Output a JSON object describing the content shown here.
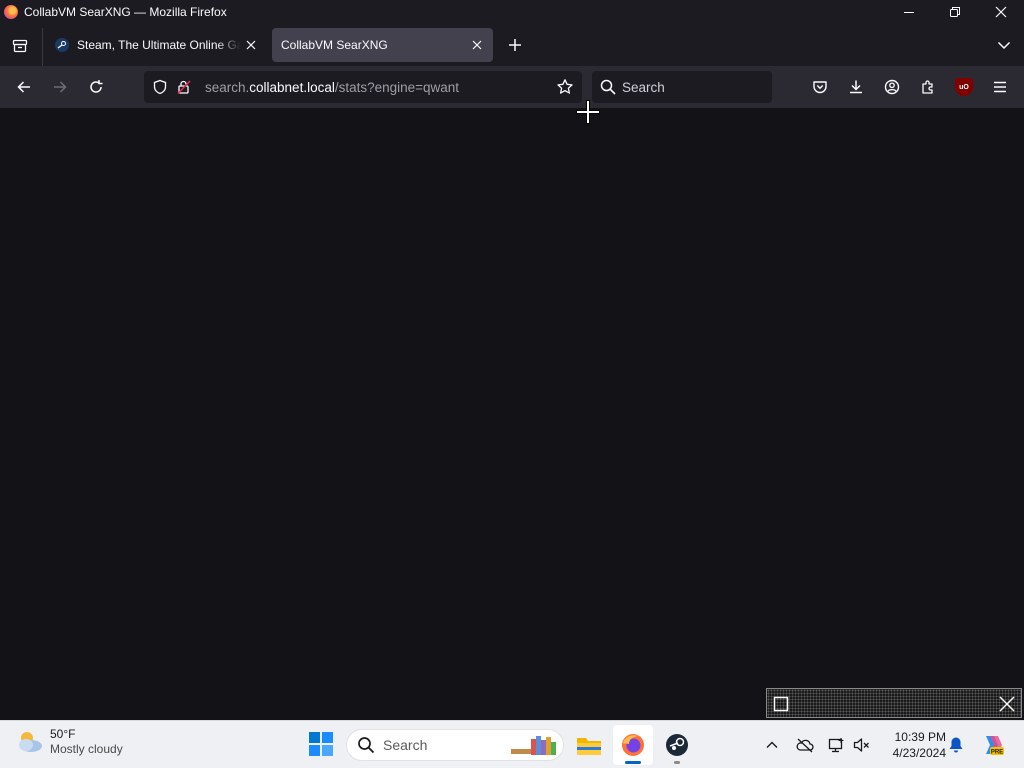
{
  "window": {
    "title": "CollabVM SearXNG — Mozilla Firefox"
  },
  "tabs": [
    {
      "title": "Steam, The Ultimate Online Game Platform",
      "active": false
    },
    {
      "title": "CollabVM SearXNG",
      "active": true
    }
  ],
  "navbar": {
    "url_prefix": "search.",
    "url_host": "collabnet.local",
    "url_path": "/stats?engine=qwant",
    "search_placeholder": "Search"
  },
  "toolbar_icons": [
    "pocket-icon",
    "downloads-icon",
    "account-icon",
    "extensions-icon",
    "ublock-origin-icon",
    "app-menu-icon"
  ],
  "ublock_badge": "uO",
  "taskbar": {
    "weather": {
      "temp": "50°F",
      "condition": "Mostly cloudy"
    },
    "search_label": "Search",
    "clock": {
      "time": "10:39 PM",
      "date": "4/23/2024"
    },
    "copilot_badge": "PRE"
  },
  "colors": {
    "titlebar": "#1c1b22",
    "navbar": "#2b2a33",
    "content": "#131217",
    "active_tab": "#42414d",
    "taskbar": "#eef0f4"
  }
}
